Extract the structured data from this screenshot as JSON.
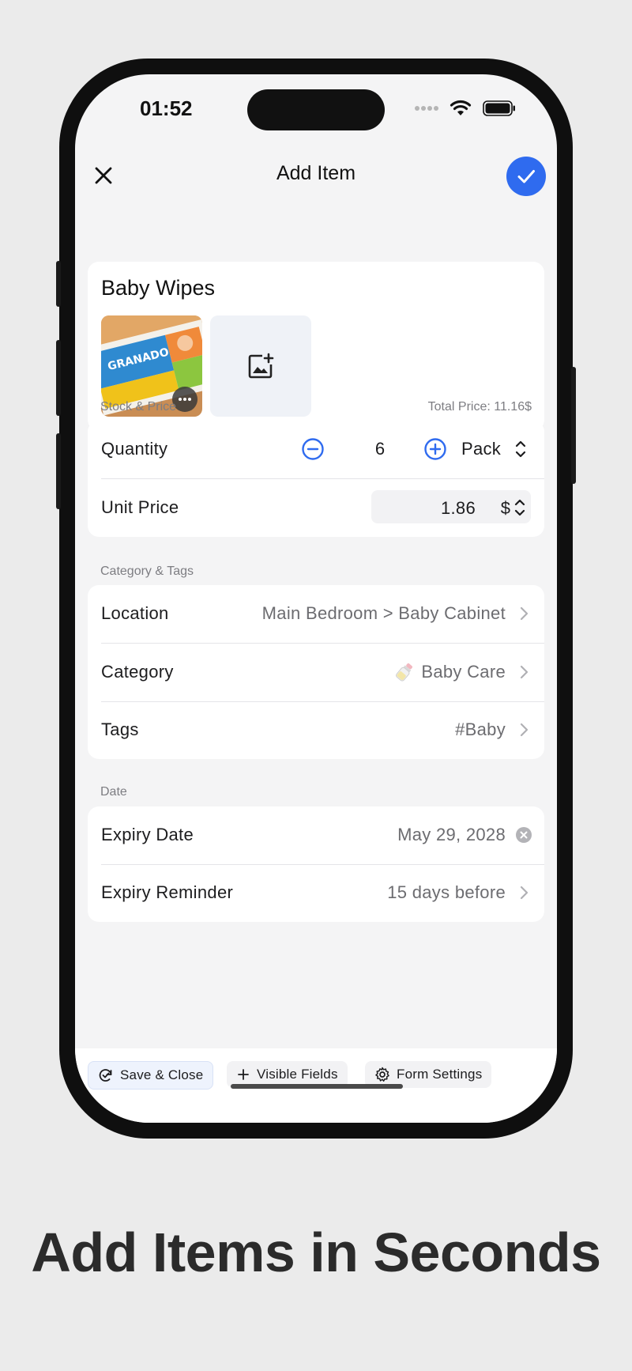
{
  "status_bar": {
    "time": "01:52"
  },
  "header": {
    "title": "Add Item"
  },
  "item": {
    "name": "Baby Wipes"
  },
  "stock_price": {
    "section_label": "Stock & Price",
    "total_price": "Total Price: 11.16$",
    "quantity_label": "Quantity",
    "quantity_value": "6",
    "unit": "Pack",
    "unit_price_label": "Unit Price",
    "unit_price_value": "1.86",
    "currency": "$"
  },
  "category_tags": {
    "section_label": "Category & Tags",
    "location_label": "Location",
    "location_value": "Main Bedroom > Baby Cabinet",
    "category_label": "Category",
    "category_value": "Baby Care",
    "tags_label": "Tags",
    "tags_value": "#Baby"
  },
  "date": {
    "section_label": "Date",
    "expiry_label": "Expiry Date",
    "expiry_value": "May 29, 2028",
    "reminder_label": "Expiry Reminder",
    "reminder_value": "15 days before"
  },
  "bottom_bar": {
    "save_close": "Save & Close",
    "visible_fields": "Visible Fields",
    "form_settings": "Form Settings"
  },
  "photo_text": "GRANADO",
  "tagline": "Add Items in Seconds",
  "colors": {
    "accent": "#2f6bef",
    "background": "#f4f4f5",
    "card": "#ffffff"
  },
  "icons": [
    "close-icon",
    "checkmark-icon",
    "add-photo-icon",
    "more-icon",
    "minus-circle-icon",
    "plus-circle-icon",
    "up-down-chevron-icon",
    "chevron-right-icon",
    "clear-icon",
    "bottle-icon",
    "save-close-icon",
    "plus-icon",
    "gear-icon",
    "wifi-icon",
    "battery-icon",
    "signal-icon"
  ]
}
